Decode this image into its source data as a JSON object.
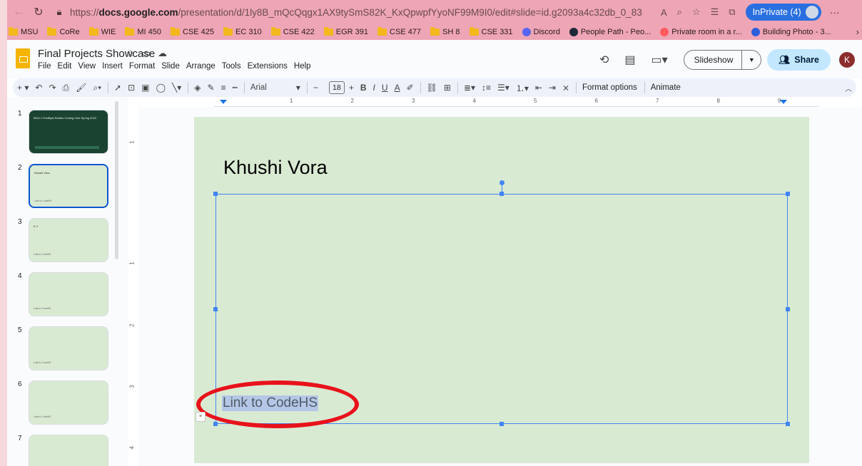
{
  "browser": {
    "url_scheme": "https://",
    "url_host": "docs.google.com",
    "url_path": "/presentation/d/1ly8B_mQcQqgx1AX9tySmS82K_KxQpwpfYyoNF99M9I0/edit#slide=id.g2093a4c32db_0_83",
    "inprivate_label": "InPrivate (4)"
  },
  "bookmarks": [
    {
      "label": "MSU",
      "type": "folder"
    },
    {
      "label": "CoRe",
      "type": "folder"
    },
    {
      "label": "WIE",
      "type": "folder"
    },
    {
      "label": "MI 450",
      "type": "folder"
    },
    {
      "label": "CSE 425",
      "type": "folder"
    },
    {
      "label": "EC 310",
      "type": "folder"
    },
    {
      "label": "CSE 422",
      "type": "folder"
    },
    {
      "label": "EGR 391",
      "type": "folder"
    },
    {
      "label": "CSE 477",
      "type": "folder"
    },
    {
      "label": "SH 8",
      "type": "folder"
    },
    {
      "label": "CSE 331",
      "type": "folder"
    },
    {
      "label": "Discord",
      "type": "site",
      "color": "#5865f2"
    },
    {
      "label": "People Path - Peo...",
      "type": "site",
      "color": "#1f2937"
    },
    {
      "label": "Private room in a r...",
      "type": "site",
      "color": "#ff5a5f"
    },
    {
      "label": "Building Photo - 3...",
      "type": "site",
      "color": "#2c5fdc"
    }
  ],
  "docs": {
    "title": "Final Projects Showcase",
    "menu": [
      "File",
      "Edit",
      "View",
      "Insert",
      "Format",
      "Slide",
      "Arrange",
      "Tools",
      "Extensions",
      "Help"
    ],
    "slideshow_label": "Slideshow",
    "share_label": "Share",
    "user_initial": "K",
    "accent": "#0b57d0"
  },
  "toolbar": {
    "font": "Arial",
    "font_size": "18",
    "format_options": "Format options",
    "animate": "Animate"
  },
  "filmstrip": {
    "slides": [
      {
        "num": "1",
        "title": "MSU x FirstByte Bodies Coding Club Spring 2022",
        "link": "",
        "dark": true
      },
      {
        "num": "2",
        "title": "Khushi Vora",
        "link": "Link to CodeHS",
        "selected": true
      },
      {
        "num": "3",
        "title": "K Y",
        "link": "Link to CodeHS"
      },
      {
        "num": "4",
        "title": "",
        "link": "Link to CodeHS"
      },
      {
        "num": "5",
        "title": "",
        "link": "Link to CodeHS"
      },
      {
        "num": "6",
        "title": "",
        "link": "Link to CodeHS"
      },
      {
        "num": "7",
        "title": "",
        "link": ""
      }
    ]
  },
  "ruler": {
    "top": [
      "1",
      "2",
      "3",
      "4",
      "5",
      "6",
      "7",
      "8",
      "9"
    ],
    "left": [
      "1",
      "1",
      "2",
      "3",
      "4"
    ]
  },
  "slide": {
    "title": "Khushi Vora",
    "link_text": "Link to CodeHS",
    "background": "#d9ead3",
    "highlight_color": "#e8121b"
  }
}
